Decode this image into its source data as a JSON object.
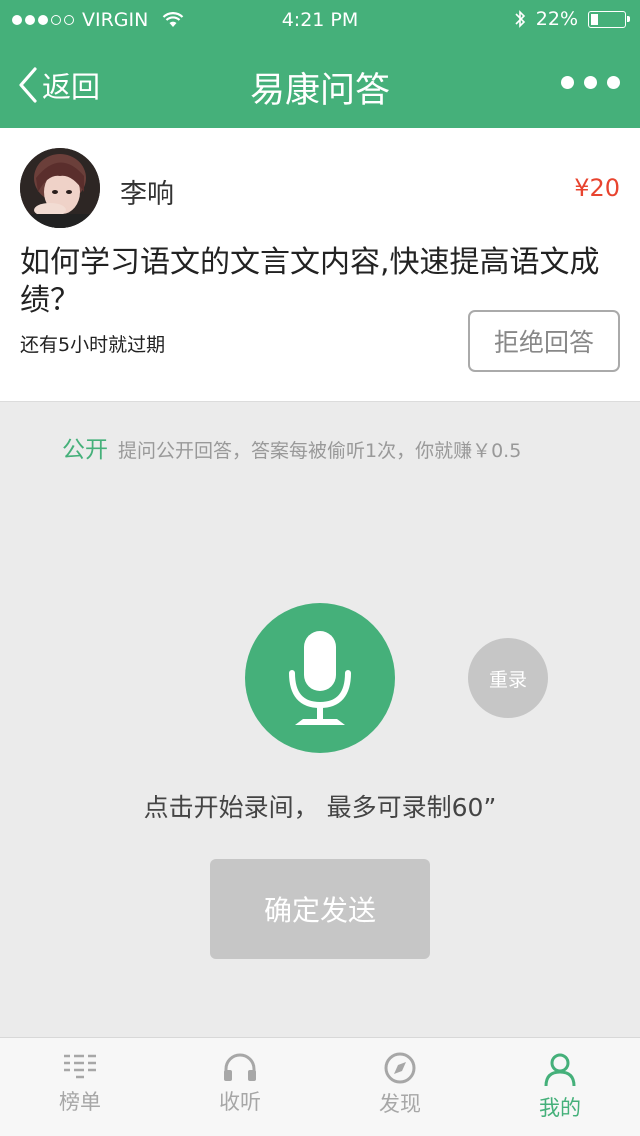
{
  "status": {
    "carrier": "VIRGIN",
    "time": "4:21 PM",
    "battery": "22%",
    "battery_level": 0.22
  },
  "nav": {
    "back_label": "返回",
    "title": "易康问答"
  },
  "question": {
    "user_name": "李响",
    "price": "¥20",
    "text": "如何学习语文的文言文内容,快速提高语文成绩？",
    "expire_text": "还有5小时就过期",
    "reject_label": "拒绝回答"
  },
  "public": {
    "tag": "公开",
    "note": "提问公开回答，答案每被偷听1次，你就赚￥0.5"
  },
  "record": {
    "rerecord_label": "重录",
    "hint": "点击开始录间， 最多可录制60”",
    "send_label": "确定发送"
  },
  "tabs": [
    {
      "label": "榜单",
      "icon": "list-icon",
      "active": false
    },
    {
      "label": "收听",
      "icon": "headphones-icon",
      "active": false
    },
    {
      "label": "发现",
      "icon": "compass-icon",
      "active": false
    },
    {
      "label": "我的",
      "icon": "person-icon",
      "active": true
    }
  ],
  "colors": {
    "brand": "#45b07a",
    "price": "#e8442f"
  }
}
